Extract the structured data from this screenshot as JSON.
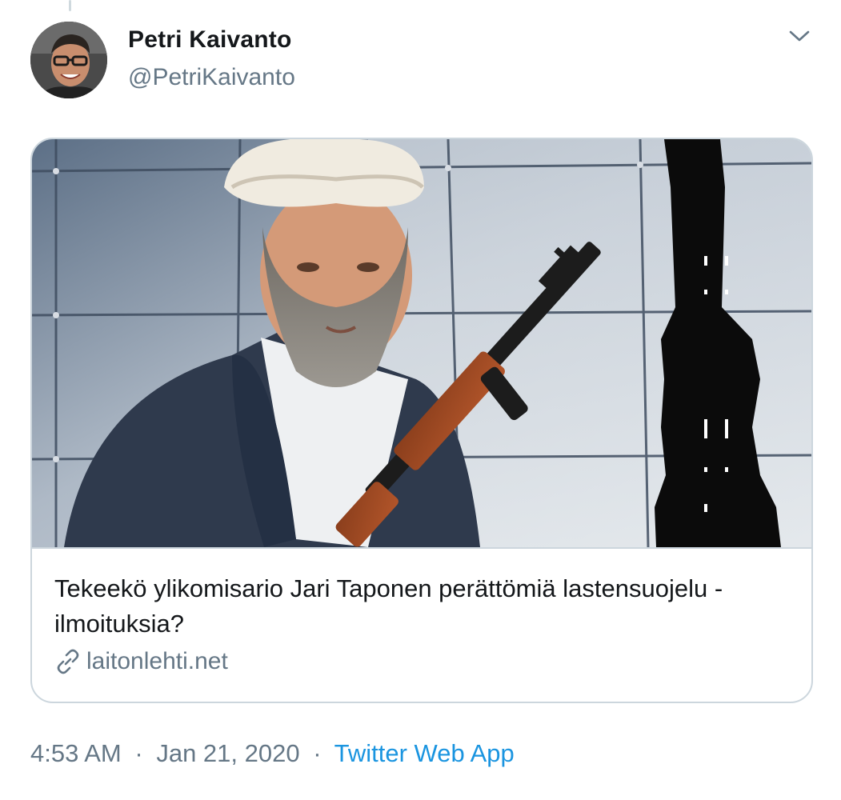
{
  "tweet": {
    "author": {
      "name": "Petri Kaivanto",
      "handle": "@PetriKaivanto"
    },
    "card": {
      "title": "Tekeekö ylikomisario Jari Taponen perättömiä lastensuojelu -ilmoituksia?",
      "domain": "laitonlehti.net",
      "link_icon": "link-icon"
    },
    "meta": {
      "time": "4:53 AM",
      "separator_1": "·",
      "date": "Jan 21, 2020",
      "separator_2": "·",
      "source": "Twitter Web App"
    },
    "icons": {
      "menu": "chevron-down-icon",
      "link": "link-icon"
    },
    "colors": {
      "name": "#14171a",
      "secondary_text": "#657786",
      "accent_link": "#1b95e0",
      "border": "#ccd6dd"
    }
  }
}
